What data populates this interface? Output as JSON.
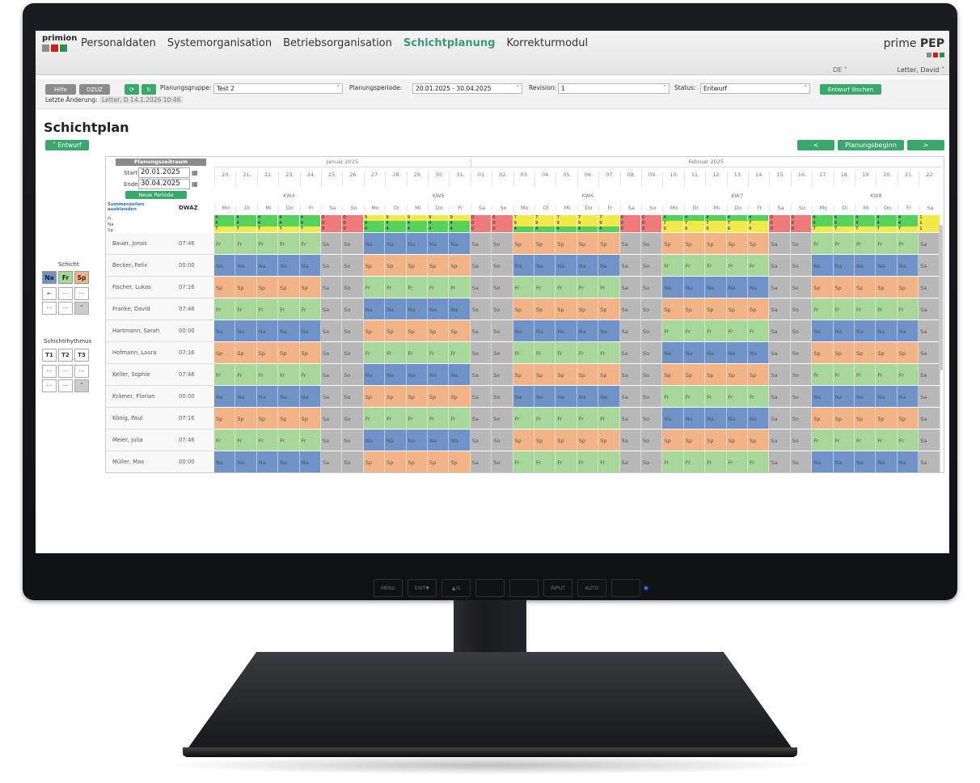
{
  "app": {
    "logo_text": "primion",
    "nav": [
      "Personaldaten",
      "Systemorganisation",
      "Betriebsorganisation",
      "Schichtplanung",
      "Korrekturmodul"
    ],
    "active_nav": "Schichtplanung",
    "brand_plain": "prime",
    "brand_bold": "PEP",
    "language": "DE ˅",
    "user": "Letter, David ˅"
  },
  "toolbar": {
    "hilfe": "Hilfe",
    "dwz": "DZUZ",
    "group_label": "Planungsgruppe:",
    "group_value": "Test 2",
    "period_label": "Planungsperiode:",
    "period_value": "20.01.2025 - 30.04.2025",
    "revision_label": "Revision:",
    "revision_value": "1",
    "status_label": "Status:",
    "status_value": "Entwurf",
    "delete_btn": "Entwurf löschen",
    "last_change_label": "Letzte Änderung:",
    "last_change_value": "Letter, D 14.1.2026 10:46"
  },
  "page": {
    "title": "Schichtplan",
    "draft_btn": "˅ Entwurf",
    "prev": "<",
    "plan_start": "Planungsbeginn",
    "next": ">"
  },
  "period_box": {
    "title": "Planungszeitraum",
    "start_label": "Start:",
    "start": "20.01.2025",
    "end_label": "Ende:",
    "end": "30.04.2025",
    "new_btn": "Neue Periode",
    "hide_sums": "Summenzeilen ausblenden",
    "dwaz": "DWAZ",
    "sum_rows": [
      "Fr",
      "Na",
      "Sp"
    ]
  },
  "shift_panel": {
    "title": "Schicht",
    "tiles": [
      "Na",
      "Fr",
      "Sp"
    ],
    "small": [
      "←",
      "···",
      "···",
      "···",
      "···",
      "˅"
    ]
  },
  "rhythm_panel": {
    "title": "Schichtrhythmus",
    "tiles": [
      "T1",
      "T2",
      "T3"
    ],
    "small": [
      "···",
      "···",
      "···",
      "···",
      "···",
      "˅"
    ]
  },
  "months": [
    "Januar 2025",
    "Februar 2025"
  ],
  "weeks": [
    "KW4",
    "KW5",
    "KW6",
    "KW7",
    "KW8"
  ],
  "dates": [
    "20.",
    "21.",
    "22.",
    "23.",
    "24.",
    "25.",
    "26.",
    "27.",
    "28.",
    "29.",
    "30.",
    "31.",
    "01.",
    "02.",
    "03.",
    "04.",
    "05.",
    "06.",
    "07.",
    "08.",
    "09.",
    "10.",
    "11.",
    "12.",
    "13.",
    "14.",
    "15.",
    "16.",
    "17.",
    "18.",
    "19.",
    "20.",
    "21.",
    "22."
  ],
  "weekdays": [
    "Mo",
    "Di",
    "Mi",
    "Do",
    "Fr",
    "Sa",
    "So",
    "Mo",
    "Di",
    "Mi",
    "Do",
    "Fr",
    "Sa",
    "So",
    "Mo",
    "Di",
    "Mi",
    "Do",
    "Fr",
    "Sa",
    "So",
    "Mo",
    "Di",
    "Mi",
    "Do",
    "Fr",
    "Sa",
    "So",
    "Mo",
    "Di",
    "Mi",
    "Do",
    "Fr",
    "Sa"
  ],
  "sum_values": {
    "Fr": [
      "4",
      "4",
      "4",
      "4",
      "4",
      "0",
      "0",
      "9",
      "9",
      "9",
      "9",
      "9",
      "0",
      "0",
      "7",
      "7",
      "7",
      "7",
      "7",
      "0",
      "0",
      "4",
      "4",
      "4",
      "4",
      "4",
      "0",
      "0",
      "4",
      "4",
      "4",
      "4",
      "4",
      "1"
    ],
    "Na": [
      "4",
      "4",
      "4",
      "4",
      "4",
      "0",
      "0",
      "4",
      "4",
      "4",
      "4",
      "4",
      "0",
      "0",
      "9",
      "9",
      "9",
      "9",
      "9",
      "0",
      "0",
      "7",
      "7",
      "7",
      "7",
      "7",
      "0",
      "0",
      "4",
      "4",
      "4",
      "4",
      "4",
      "1"
    ],
    "Sp": [
      "7",
      "7",
      "7",
      "7",
      "7",
      "0",
      "0",
      "4",
      "4",
      "4",
      "4",
      "4",
      "0",
      "0",
      "4",
      "4",
      "4",
      "4",
      "4",
      "0",
      "0",
      "9",
      "9",
      "9",
      "9",
      "9",
      "0",
      "0",
      "7",
      "7",
      "7",
      "7",
      "7",
      "1"
    ]
  },
  "employees": [
    {
      "name": "Bauer, Jonas",
      "dwaz": "07:46",
      "weeks": [
        "Fr",
        "Na",
        "Sp",
        "Sp",
        "Fr"
      ]
    },
    {
      "name": "Becker, Felix",
      "dwaz": "00:00",
      "weeks": [
        "Na",
        "Sp",
        "Na",
        "Fr",
        "Na"
      ]
    },
    {
      "name": "Fischer, Lukas",
      "dwaz": "07:16",
      "weeks": [
        "Sp",
        "Fr",
        "Fr",
        "Na",
        "Sp"
      ]
    },
    {
      "name": "Franke, David",
      "dwaz": "07:46",
      "weeks": [
        "Fr",
        "Na",
        "Sp",
        "Sp",
        "Fr"
      ]
    },
    {
      "name": "Hartmann, Sarah",
      "dwaz": "00:00",
      "weeks": [
        "Na",
        "Sp",
        "Na",
        "Fr",
        "Na"
      ]
    },
    {
      "name": "Hofmann, Laura",
      "dwaz": "07:16",
      "weeks": [
        "Sp",
        "Fr",
        "Fr",
        "Na",
        "Sp"
      ]
    },
    {
      "name": "Keller, Sophie",
      "dwaz": "07:46",
      "weeks": [
        "Fr",
        "Na",
        "Sp",
        "Sp",
        "Fr"
      ]
    },
    {
      "name": "Krämer, Florian",
      "dwaz": "00:00",
      "weeks": [
        "Na",
        "Sp",
        "Na",
        "Fr",
        "Na"
      ]
    },
    {
      "name": "König, Paul",
      "dwaz": "07:16",
      "weeks": [
        "Sp",
        "Fr",
        "Fr",
        "Na",
        "Sp"
      ]
    },
    {
      "name": "Meier, Julia",
      "dwaz": "07:46",
      "weeks": [
        "Fr",
        "Na",
        "Sp",
        "Sp",
        "Fr"
      ]
    },
    {
      "name": "Müller, Max",
      "dwaz": "00:00",
      "weeks": [
        "Na",
        "Sp",
        "Fr",
        "Fr",
        "Na"
      ]
    }
  ],
  "weekend_label": [
    "Sa",
    "So"
  ],
  "monitor_buttons": [
    "MENU",
    "EXIT▼",
    "▲/S",
    "",
    "",
    "INPUT",
    "AUTO",
    ""
  ],
  "colors": {
    "green": "#3aa86a",
    "night": "#6f93c8",
    "early": "#a8d79a",
    "late": "#f2b486",
    "weekend": "#b8b8b8"
  }
}
